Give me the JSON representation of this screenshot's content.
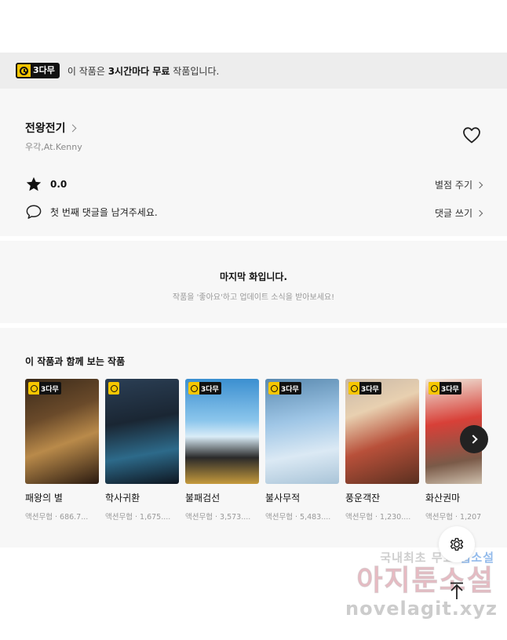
{
  "free_banner": {
    "badge": "3다무",
    "text_prefix": "이 작품은 ",
    "text_bold": "3시간마다 무료",
    "text_suffix": " 작품입니다."
  },
  "work": {
    "title": "전왕전기",
    "author": "우각,At.Kenny",
    "rating": "0.0",
    "rate_link": "별점 주기",
    "comment_prompt": "첫 번째 댓글을 남겨주세요.",
    "comment_link": "댓글 쓰기"
  },
  "last_episode": {
    "title": "마지막 화입니다.",
    "subtitle": "작품을 '좋아요'하고 업데이트 소식을 받아보세요!"
  },
  "recommendations": {
    "heading": "이 작품과 함께 보는 작품",
    "badge": "3다무",
    "items": [
      {
        "title": "패왕의 별",
        "meta": "액션무협 · 686.7..."
      },
      {
        "title": "학사귀환",
        "meta": "액션무협 · 1,675...."
      },
      {
        "title": "불패검선",
        "meta": "액션무협 · 3,573...."
      },
      {
        "title": "불사무적",
        "meta": "액션무협 · 5,483...."
      },
      {
        "title": "풍운객잔",
        "meta": "액션무협 · 1,230...."
      },
      {
        "title": "화산권마",
        "meta": "액션무협 · 1,207"
      }
    ]
  },
  "watermark": {
    "line1_a": "국내최초 무료 ",
    "line1_b": "웹소설",
    "line2": "아지툰소설",
    "line3": "novelagit.xyz"
  },
  "icons": {
    "heart": "heart-icon",
    "star": "star-icon",
    "comment": "speech-bubble-icon",
    "next": "chevron-right-icon",
    "settings": "gear-icon",
    "top": "arrow-up-icon"
  }
}
